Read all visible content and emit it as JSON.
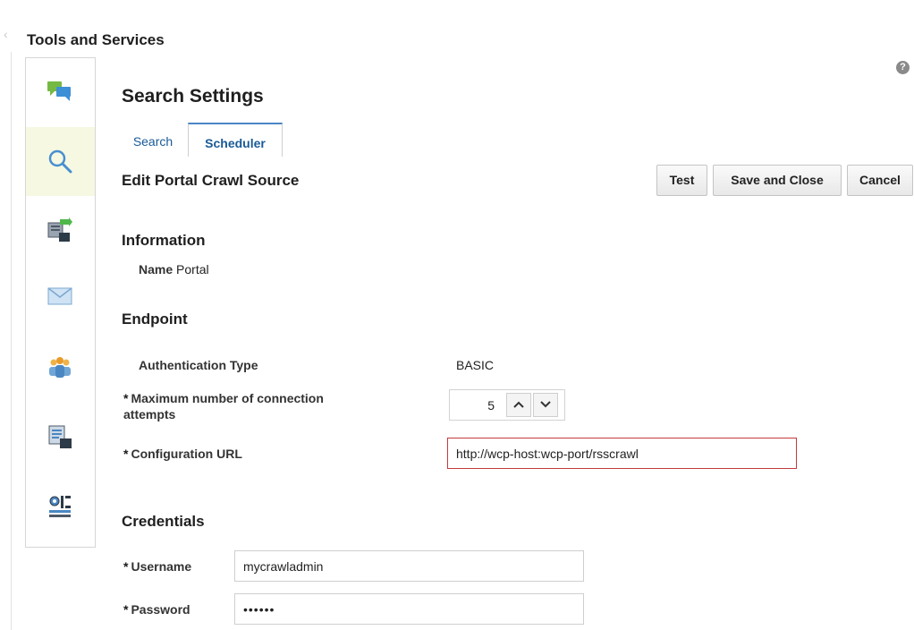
{
  "panel": {
    "title": "Tools and Services",
    "collapse_glyph": "‹"
  },
  "toolbar": {
    "items": [
      {
        "icon": "chat-bubbles-icon",
        "selected": false
      },
      {
        "icon": "search-icon",
        "selected": true
      },
      {
        "icon": "export-document-icon",
        "selected": false
      },
      {
        "icon": "envelope-icon",
        "selected": false
      },
      {
        "icon": "people-icon",
        "selected": false
      },
      {
        "icon": "document-computer-icon",
        "selected": false
      },
      {
        "icon": "network-settings-icon",
        "selected": false
      }
    ]
  },
  "help": {
    "glyph": "?"
  },
  "page": {
    "title": "Search Settings"
  },
  "tabs": [
    {
      "label": "Search",
      "selected": false
    },
    {
      "label": "Scheduler",
      "selected": true
    }
  ],
  "form": {
    "title": "Edit Portal Crawl Source",
    "buttons": {
      "test": "Test",
      "save_close": "Save and Close",
      "cancel": "Cancel"
    }
  },
  "information": {
    "heading": "Information",
    "name_label": "Name",
    "name_value": "Portal"
  },
  "endpoint": {
    "heading": "Endpoint",
    "auth_label": "Authentication Type",
    "auth_value": "BASIC",
    "max_attempts_label_line1": "Maximum number of connection",
    "max_attempts_label_line2": "attempts",
    "max_attempts_value": "5",
    "config_url_label": "Configuration URL",
    "config_url_value": "http://wcp-host:wcp-port/rsscrawl",
    "required_marker": "*"
  },
  "credentials": {
    "heading": "Credentials",
    "username_label": "Username",
    "username_value": "mycrawladmin",
    "password_label": "Password",
    "password_value": "••••••"
  },
  "colors": {
    "accent": "#4a86c5",
    "selected_tool_bg": "#f6f8e2",
    "error_border": "#c23b3b",
    "link": "#1a5a96"
  }
}
